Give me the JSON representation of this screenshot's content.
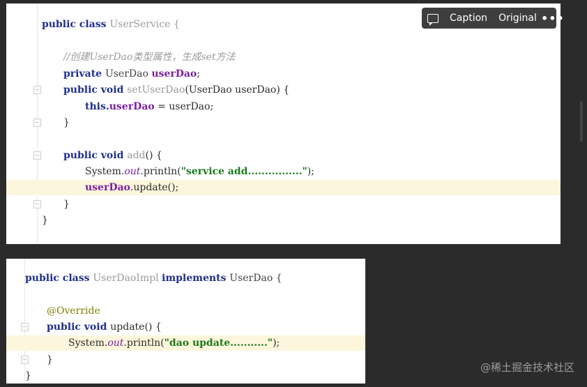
{
  "toolbar": {
    "caption_label": "Caption",
    "original_label": "Original",
    "more_label": "•••"
  },
  "panel1": {
    "l1": {
      "a": "public class ",
      "b": "UserService",
      "c": " {"
    },
    "comment": "//创建UserDao类型属性，生成set方法",
    "l3": {
      "a": "private ",
      "b": "UserDao ",
      "c": "userDao",
      "d": ";"
    },
    "l4": {
      "a": "public void ",
      "b": "setUserDao",
      "c": "(UserDao userDao) {"
    },
    "l5": {
      "a": "this.",
      "b": "userDao",
      "c": " = userDao;"
    },
    "close1": "}",
    "l7": {
      "a": "public void ",
      "b": "add",
      "c": "() {"
    },
    "l8": {
      "a": "System.",
      "b": "out",
      "c": ".println(",
      "d": "\"service add................\"",
      "e": ");"
    },
    "l9": {
      "a": "userDao",
      "b": ".update();"
    },
    "close2": "}",
    "close3": "}"
  },
  "panel2": {
    "l1": {
      "a": "public class ",
      "b": "UserDaoImpl ",
      "c": "implements ",
      "d": "UserDao {"
    },
    "ann": "@Override",
    "l3": {
      "a": "public void ",
      "b": "update() {"
    },
    "l4": {
      "a": "System.",
      "b": "out",
      "c": ".println(",
      "d": "\"dao update...........\"",
      "e": ");"
    },
    "close1": "}",
    "close2": "}"
  },
  "watermark": "@稀土掘金技术社区"
}
